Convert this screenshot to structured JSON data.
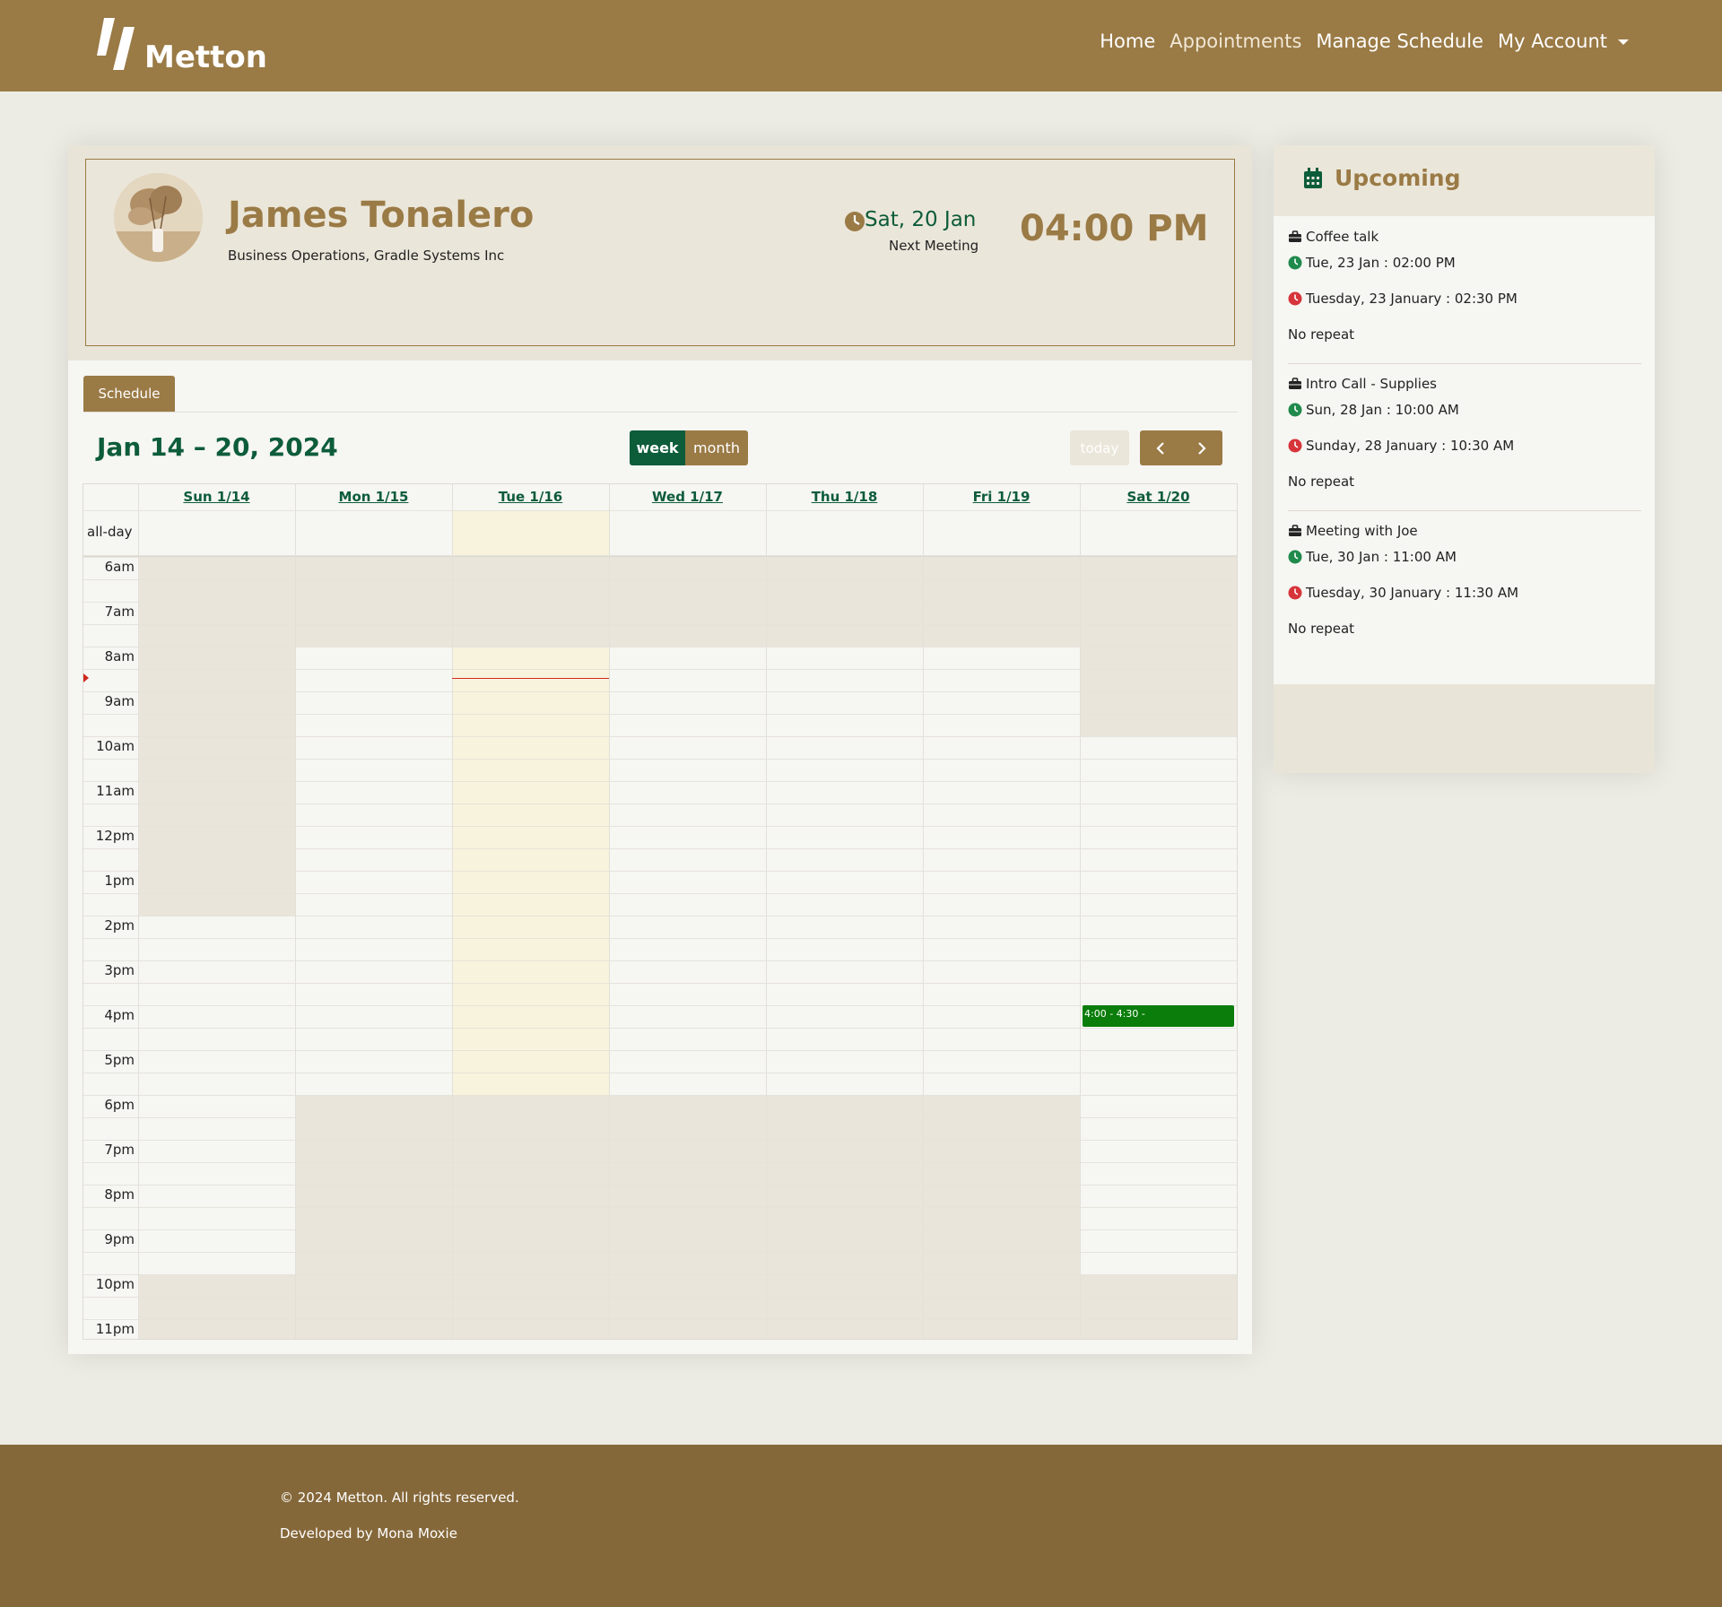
{
  "brand": {
    "name": "Metton"
  },
  "nav": {
    "items": [
      "Home",
      "Appointments",
      "Manage Schedule",
      "My Account"
    ]
  },
  "profile": {
    "name": "James Tonalero",
    "role": "Business Operations, Gradle Systems Inc",
    "next_meeting_date": "Sat, 20 Jan",
    "next_meeting_label": "Next Meeting",
    "next_meeting_time": "04:00 PM",
    "avatar_icon": "dried-pampas-vase-photo"
  },
  "schedule": {
    "tab_label": "Schedule",
    "title": "Jan 14 – 20, 2024",
    "view_buttons": {
      "week": "week",
      "month": "month"
    },
    "today_label": "today",
    "days": [
      "Sun 1/14",
      "Mon 1/15",
      "Tue 1/16",
      "Wed 1/17",
      "Thu 1/18",
      "Fri 1/19",
      "Sat 1/20"
    ],
    "allday_label": "all-day",
    "hours": [
      "6am",
      "7am",
      "8am",
      "9am",
      "10am",
      "11am",
      "12pm",
      "1pm",
      "2pm",
      "3pm",
      "4pm",
      "5pm",
      "6pm",
      "7pm",
      "8pm",
      "9pm",
      "10pm",
      "11pm"
    ],
    "events": [
      {
        "day": "Sat 1/20",
        "label": "4:00 - 4:30 -",
        "color": "#0a7d0a"
      }
    ]
  },
  "upcoming": {
    "title": "Upcoming",
    "items": [
      {
        "title": "Coffee talk",
        "start": "Tue, 23 Jan : 02:00 PM",
        "end": "Tuesday, 23 January : 02:30 PM",
        "repeat": "No repeat"
      },
      {
        "title": "Intro Call - Supplies",
        "start": "Sun, 28 Jan : 10:00 AM",
        "end": "Sunday, 28 January : 10:30 AM",
        "repeat": "No repeat"
      },
      {
        "title": "Meeting with Joe",
        "start": "Tue, 30 Jan : 11:00 AM",
        "end": "Tuesday, 30 January : 11:30 AM",
        "repeat": "No repeat"
      }
    ]
  },
  "footer": {
    "copyright": "© 2024 Metton. All rights reserved.",
    "developer": "Developed by Mona Moxie"
  },
  "colors": {
    "brand": "#9a7a45",
    "accent_green": "#0d5c3a",
    "event_green": "#0a7d0a",
    "end_time_red": "#d6343a",
    "footer": "#85683a"
  }
}
